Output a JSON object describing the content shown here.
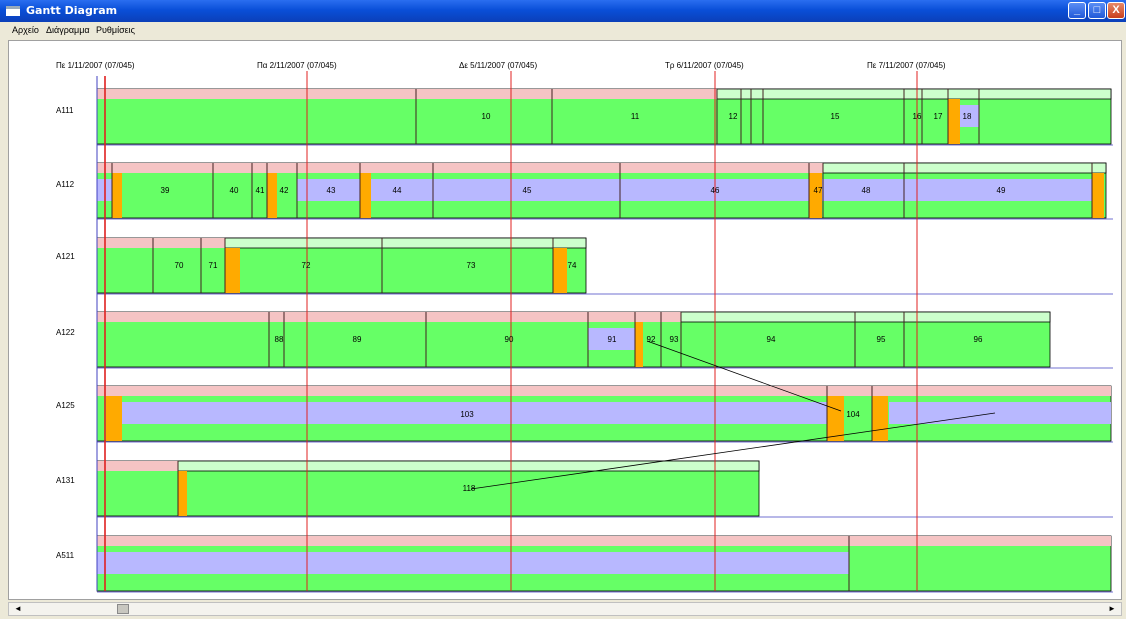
{
  "window": {
    "title": "Gantt Diagram",
    "min_label": "_",
    "max_label": "□",
    "close_label": "X"
  },
  "menu": [
    "Αρχείο",
    "Διάγραμμα",
    "Ρυθμίσεις"
  ],
  "date_axis": [
    "Πε 1/11/2007 (07/045)",
    "Πα 2/11/2007 (07/045)",
    "Δε 5/11/2007 (07/045)",
    "Τρ 6/11/2007 (07/045)",
    "Πε 7/11/2007 (07/045)"
  ],
  "resources": [
    "Α111",
    "Α112",
    "Α121",
    "Α122",
    "Α125",
    "Α131",
    "Α511"
  ],
  "tasks": {
    "A111": [
      "10",
      "11",
      "12",
      "15",
      "16",
      "17",
      "18"
    ],
    "A112": [
      "39",
      "40",
      "41",
      "42",
      "43",
      "44",
      "45",
      "46",
      "47",
      "48",
      "49"
    ],
    "A121": [
      "70",
      "71",
      "72",
      "73",
      "74"
    ],
    "A122": [
      "88",
      "89",
      "90",
      "91",
      "92",
      "93",
      "94",
      "95",
      "96"
    ],
    "A125": [
      "103",
      "104"
    ],
    "A131": [
      "118"
    ]
  },
  "colors": {
    "work": "#66ff66",
    "header": "#f5c4c4",
    "header_light": "#ccffcc",
    "setup": "#ffaa00",
    "idle": "#b8b8ff",
    "date_line": "#e02020",
    "row_line": "#4040c0"
  },
  "scrollbar": {
    "left_arrow": "◄",
    "right_arrow": "►"
  }
}
